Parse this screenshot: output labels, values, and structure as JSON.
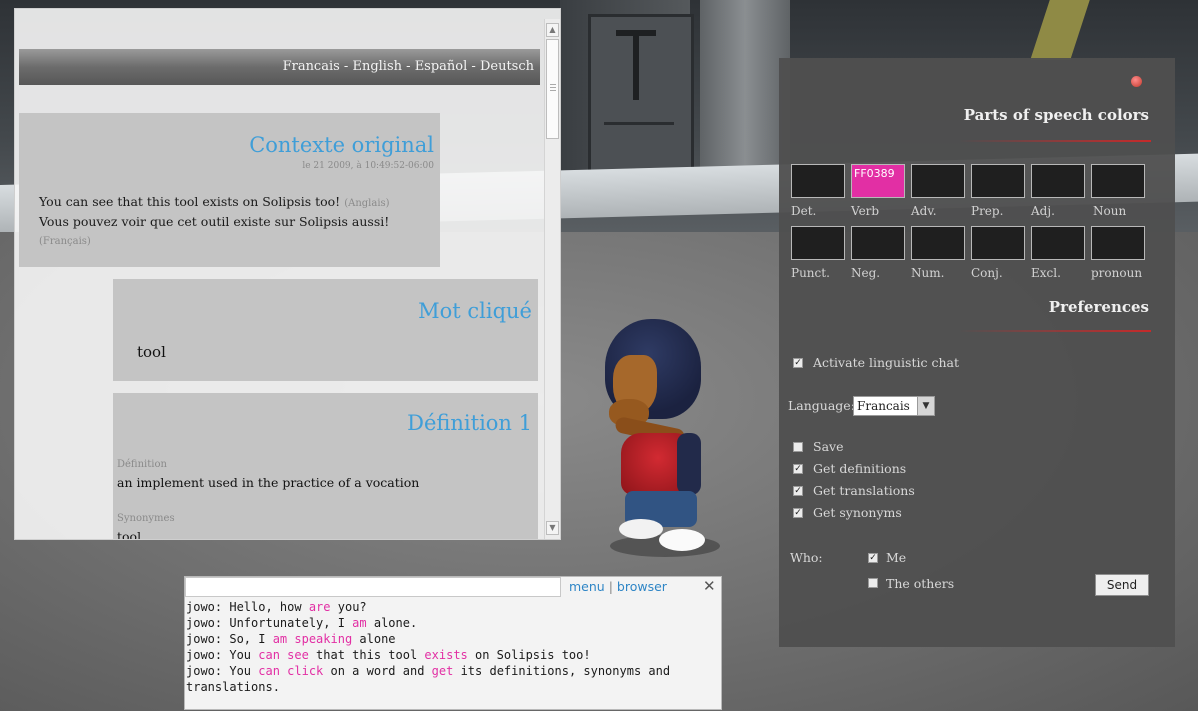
{
  "languages": {
    "items": [
      "Francais",
      "English",
      "Español",
      "Deutsch"
    ],
    "separator": " - "
  },
  "context": {
    "title": "Contexte original",
    "date": "le 21 2009, à 10:49:52-06:00",
    "sentence_en": "You can see that this tool exists on Solipsis too!",
    "sentence_en_lang": "(Anglais)",
    "sentence_fr": "Vous pouvez voir que cet outil existe sur Solipsis aussi!",
    "sentence_fr_lang": "(Français)"
  },
  "clicked_word": {
    "title": "Mot cliqué",
    "word": "tool"
  },
  "definition": {
    "title": "Définition 1",
    "definition_label": "Définition",
    "definition_text": "an implement used in the practice of a vocation",
    "synonyms_label": "Synonymes",
    "synonyms_text": "tool"
  },
  "colors": {
    "accent_blue": "#3f9ed8",
    "highlight_pink": "#e22fa4",
    "rule_red": "#c62a2a"
  },
  "prefs": {
    "title_colors": "Parts of speech colors",
    "swatches_row1": [
      {
        "label": "Det.",
        "value": ""
      },
      {
        "label": "Verb",
        "value": "FF0389"
      },
      {
        "label": "Adv.",
        "value": ""
      },
      {
        "label": "Prep.",
        "value": ""
      },
      {
        "label": "Adj.",
        "value": ""
      },
      {
        "label": "Noun",
        "value": ""
      }
    ],
    "swatches_row2": [
      {
        "label": "Punct.",
        "value": ""
      },
      {
        "label": "Neg.",
        "value": ""
      },
      {
        "label": "Num.",
        "value": ""
      },
      {
        "label": "Conj.",
        "value": ""
      },
      {
        "label": "Excl.",
        "value": ""
      },
      {
        "label": "pronoun",
        "value": ""
      }
    ],
    "title_preferences": "Preferences",
    "activate_label": "Activate linguistic chat",
    "activate_checked": true,
    "language_label": "Language:",
    "language_value": "Francais",
    "save_label": "Save",
    "save_checked": false,
    "get_definitions_label": "Get definitions",
    "get_definitions_checked": true,
    "get_translations_label": "Get translations",
    "get_translations_checked": true,
    "get_synonyms_label": "Get synonyms",
    "get_synonyms_checked": true,
    "who_label": "Who:",
    "me_label": "Me",
    "me_checked": true,
    "others_label": "The others",
    "others_checked": false,
    "send_label": "Send"
  },
  "chat": {
    "menu_label": "menu",
    "separator": "|",
    "browser_label": "browser",
    "close_symbol": "✕",
    "lines": [
      [
        {
          "t": "jowo: Hello, how ",
          "h": false
        },
        {
          "t": "are",
          "h": true
        },
        {
          "t": " you?",
          "h": false
        }
      ],
      [
        {
          "t": "jowo: Unfortunately, I ",
          "h": false
        },
        {
          "t": "am",
          "h": true
        },
        {
          "t": " alone.",
          "h": false
        }
      ],
      [
        {
          "t": "jowo: So, I ",
          "h": false
        },
        {
          "t": "am speaking",
          "h": true
        },
        {
          "t": " alone",
          "h": false
        }
      ],
      [
        {
          "t": "jowo: You ",
          "h": false
        },
        {
          "t": "can see",
          "h": true
        },
        {
          "t": " that this tool ",
          "h": false
        },
        {
          "t": "exists",
          "h": true
        },
        {
          "t": " on Solipsis too!",
          "h": false
        }
      ],
      [
        {
          "t": "jowo: You ",
          "h": false
        },
        {
          "t": "can click",
          "h": true
        },
        {
          "t": " on a word and ",
          "h": false
        },
        {
          "t": "get",
          "h": true
        },
        {
          "t": " its definitions, synonyms and",
          "h": false
        }
      ],
      [
        {
          "t": "translations.",
          "h": false
        }
      ]
    ]
  }
}
